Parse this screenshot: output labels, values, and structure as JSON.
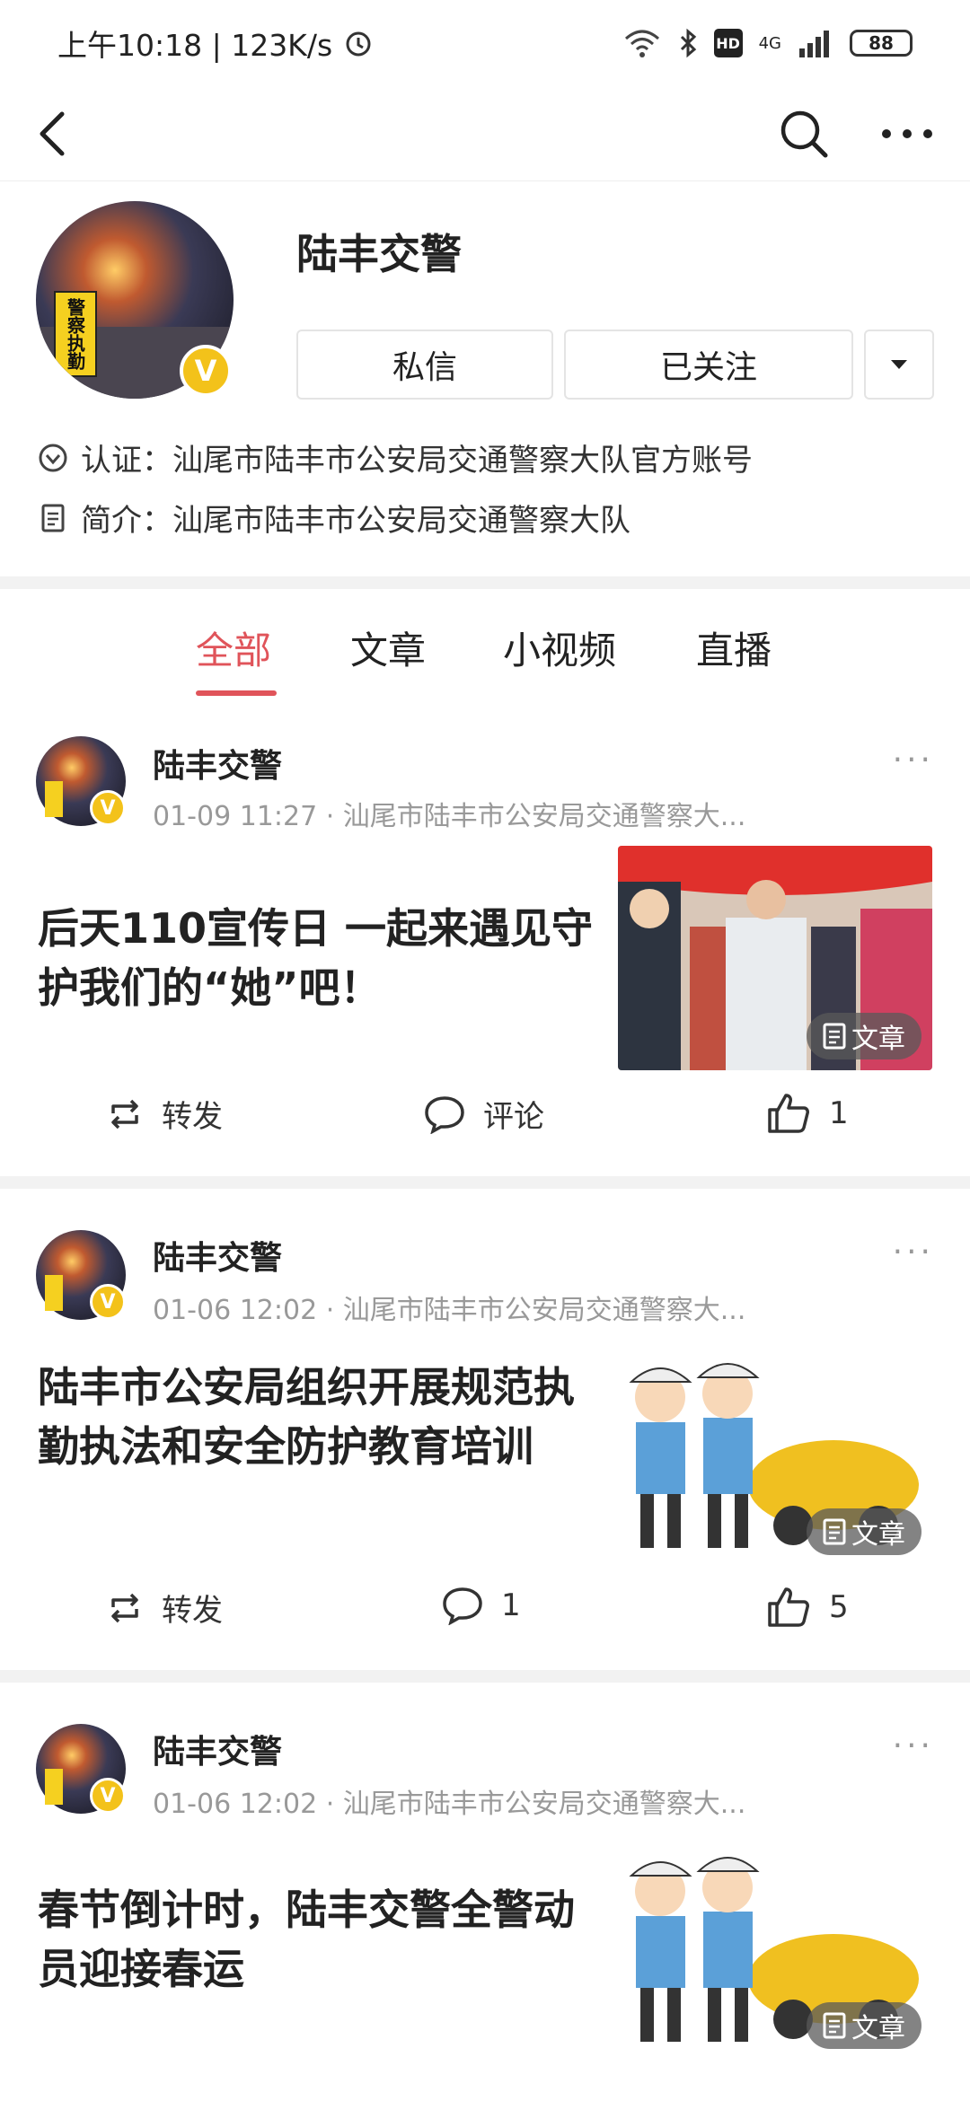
{
  "status_bar": {
    "time": "上午10:18 | 123K/s",
    "network": "4G",
    "hd": "HD",
    "battery": "88"
  },
  "nav": {
    "back_icon": "back-arrow-icon",
    "search_icon": "search-icon",
    "more_icon": "more-dots-icon"
  },
  "profile": {
    "name": "陆丰交警",
    "avatar_sign": "警察执勤",
    "verified_badge": "V",
    "message_button": "私信",
    "follow_button": "已关注",
    "certification_label": "认证：",
    "certification_value": "汕尾市陆丰市公安局交通警察大队官方账号",
    "intro_label": "简介：",
    "intro_value": "汕尾市陆丰市公安局交通警察大队"
  },
  "tabs": [
    {
      "label": "全部",
      "active": true
    },
    {
      "label": "文章",
      "active": false
    },
    {
      "label": "小视频",
      "active": false
    },
    {
      "label": "直播",
      "active": false
    }
  ],
  "posts": [
    {
      "author": "陆丰交警",
      "meta": "01-09 11:27 · 汕尾市陆丰市公安局交通警察大...",
      "title": "后天110宣传日 一起来遇见守护我们的“她”吧！",
      "badge": "文章",
      "repost_label": "转发",
      "comment_label": "评论",
      "like_count": "1"
    },
    {
      "author": "陆丰交警",
      "meta": "01-06 12:02 · 汕尾市陆丰市公安局交通警察大...",
      "title": "陆丰市公安局组织开展规范执勤执法和安全防护教育培训",
      "badge": "文章",
      "repost_label": "转发",
      "comment_label": "1",
      "like_count": "5"
    },
    {
      "author": "陆丰交警",
      "meta": "01-06 12:02 · 汕尾市陆丰市公安局交通警察大...",
      "title": "春节倒计时，陆丰交警全警动员迎接春运",
      "badge": "文章"
    }
  ],
  "colors": {
    "accent": "#e0545a",
    "badge": "#f3c21a"
  }
}
